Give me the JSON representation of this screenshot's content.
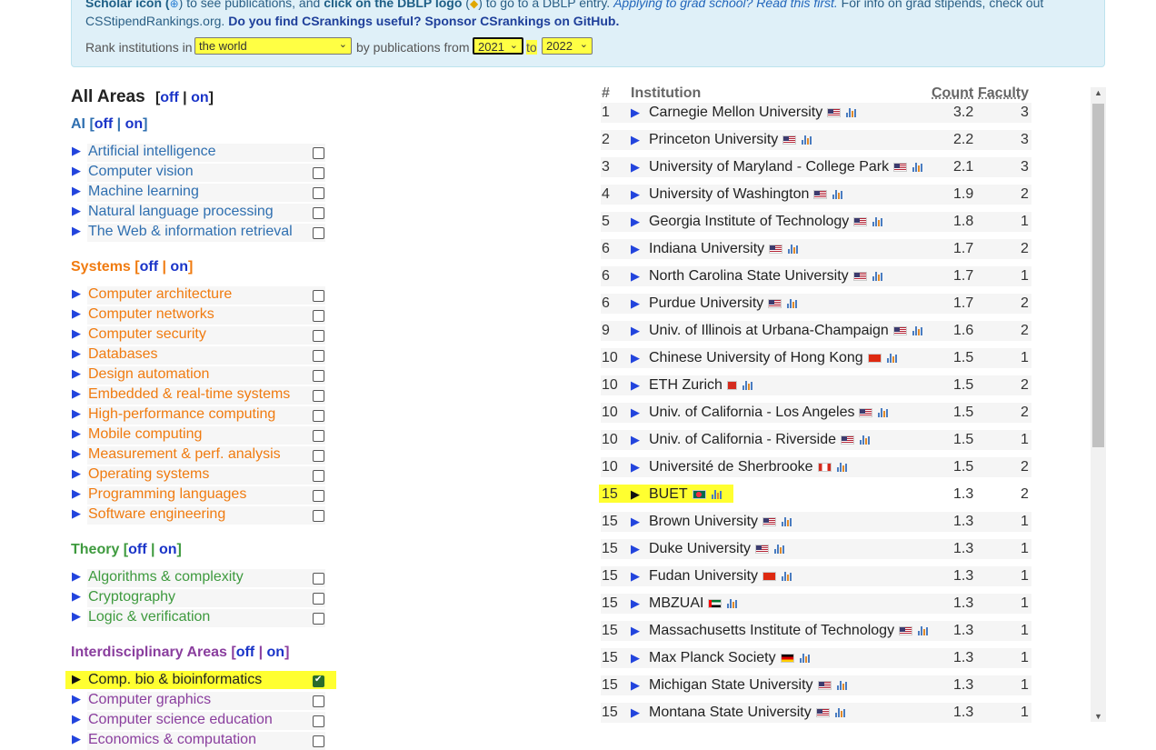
{
  "info": {
    "line1_a": "Scholar icon (",
    "line1_b": ") to see publications, and ",
    "line1_click": "click on the DBLP logo",
    "line1_c": " (",
    "line1_d": ") to go to a DBLP entry. ",
    "line1_italic": "Applying to grad school? Read this first.",
    "line1_e": " For info on grad stipends, check out",
    "line2_a": "CSStipendRankings.org.",
    "line2_b": "Do you find CSrankings useful?",
    "line2_c": "Sponsor CSrankings on GitHub."
  },
  "rank": {
    "prefix": "Rank institutions in",
    "region": "the world",
    "mid": "by publications from",
    "from_year": "2021",
    "to_word": "to",
    "to_year": "2022"
  },
  "all_areas": {
    "title": "All Areas",
    "off": "off",
    "on": "on"
  },
  "categories": [
    {
      "name": "AI",
      "off": "off",
      "on": "on",
      "color": "#2f6fb0",
      "areas": [
        {
          "label": "Artificial intelligence",
          "checked": false
        },
        {
          "label": "Computer vision",
          "checked": false
        },
        {
          "label": "Machine learning",
          "checked": false
        },
        {
          "label": "Natural language processing",
          "checked": false
        },
        {
          "label": "The Web & information retrieval",
          "checked": false
        }
      ]
    },
    {
      "name": "Systems",
      "off": "off",
      "on": "on",
      "color": "#f07b10",
      "areas": [
        {
          "label": "Computer architecture",
          "checked": false
        },
        {
          "label": "Computer networks",
          "checked": false
        },
        {
          "label": "Computer security",
          "checked": false
        },
        {
          "label": "Databases",
          "checked": false
        },
        {
          "label": "Design automation",
          "checked": false
        },
        {
          "label": "Embedded & real-time systems",
          "checked": false
        },
        {
          "label": "High-performance computing",
          "checked": false
        },
        {
          "label": "Mobile computing",
          "checked": false
        },
        {
          "label": "Measurement & perf. analysis",
          "checked": false
        },
        {
          "label": "Operating systems",
          "checked": false
        },
        {
          "label": "Programming languages",
          "checked": false
        },
        {
          "label": "Software engineering",
          "checked": false
        }
      ]
    },
    {
      "name": "Theory",
      "off": "off",
      "on": "on",
      "color": "#3e9a3e",
      "areas": [
        {
          "label": "Algorithms & complexity",
          "checked": false
        },
        {
          "label": "Cryptography",
          "checked": false
        },
        {
          "label": "Logic & verification",
          "checked": false
        }
      ]
    },
    {
      "name": "Interdisciplinary Areas",
      "off": "off",
      "on": "on",
      "color": "#8a3e9e",
      "areas": [
        {
          "label": "Comp. bio & bioinformatics",
          "checked": true
        },
        {
          "label": "Computer graphics",
          "checked": false
        },
        {
          "label": "Computer science education",
          "checked": false
        },
        {
          "label": "Economics & computation",
          "checked": false
        }
      ]
    }
  ],
  "table": {
    "col_rank": "#",
    "col_institution": "Institution",
    "col_count": "Count",
    "col_faculty": "Faculty",
    "rows": [
      {
        "rank": "1",
        "name": "Carnegie Mellon University",
        "flag": "us",
        "count": "3.2",
        "faculty": "3"
      },
      {
        "rank": "2",
        "name": "Princeton University",
        "flag": "us",
        "count": "2.2",
        "faculty": "3"
      },
      {
        "rank": "3",
        "name": "University of Maryland - College Park",
        "flag": "us",
        "count": "2.1",
        "faculty": "3"
      },
      {
        "rank": "4",
        "name": "University of Washington",
        "flag": "us",
        "count": "1.9",
        "faculty": "2"
      },
      {
        "rank": "5",
        "name": "Georgia Institute of Technology",
        "flag": "us",
        "count": "1.8",
        "faculty": "1"
      },
      {
        "rank": "6",
        "name": "Indiana University",
        "flag": "us",
        "count": "1.7",
        "faculty": "2"
      },
      {
        "rank": "6",
        "name": "North Carolina State University",
        "flag": "us",
        "count": "1.7",
        "faculty": "1"
      },
      {
        "rank": "6",
        "name": "Purdue University",
        "flag": "us",
        "count": "1.7",
        "faculty": "2"
      },
      {
        "rank": "9",
        "name": "Univ. of Illinois at Urbana-Champaign",
        "flag": "us",
        "count": "1.6",
        "faculty": "2"
      },
      {
        "rank": "10",
        "name": "Chinese University of Hong Kong",
        "flag": "hk",
        "count": "1.5",
        "faculty": "1"
      },
      {
        "rank": "10",
        "name": "ETH Zurich",
        "flag": "ch",
        "count": "1.5",
        "faculty": "2"
      },
      {
        "rank": "10",
        "name": "Univ. of California - Los Angeles",
        "flag": "us",
        "count": "1.5",
        "faculty": "2"
      },
      {
        "rank": "10",
        "name": "Univ. of California - Riverside",
        "flag": "us",
        "count": "1.5",
        "faculty": "1"
      },
      {
        "rank": "10",
        "name": "Université de Sherbrooke",
        "flag": "ca",
        "count": "1.5",
        "faculty": "2"
      },
      {
        "rank": "15",
        "name": "BUET",
        "flag": "bd",
        "count": "1.3",
        "faculty": "2",
        "highlight": true
      },
      {
        "rank": "15",
        "name": "Brown University",
        "flag": "us",
        "count": "1.3",
        "faculty": "1"
      },
      {
        "rank": "15",
        "name": "Duke University",
        "flag": "us",
        "count": "1.3",
        "faculty": "1"
      },
      {
        "rank": "15",
        "name": "Fudan University",
        "flag": "cn",
        "count": "1.3",
        "faculty": "1"
      },
      {
        "rank": "15",
        "name": "MBZUAI",
        "flag": "ae",
        "count": "1.3",
        "faculty": "1"
      },
      {
        "rank": "15",
        "name": "Massachusetts Institute of Technology",
        "flag": "us",
        "count": "1.3",
        "faculty": "1"
      },
      {
        "rank": "15",
        "name": "Max Planck Society",
        "flag": "de",
        "count": "1.3",
        "faculty": "1"
      },
      {
        "rank": "15",
        "name": "Michigan State University",
        "flag": "us",
        "count": "1.3",
        "faculty": "1"
      },
      {
        "rank": "15",
        "name": "Montana State University",
        "flag": "us",
        "count": "1.3",
        "faculty": "1"
      }
    ]
  },
  "colors": {
    "highlight": "#ffff30",
    "link": "#1a34c8",
    "arrow": "#2244dd"
  }
}
